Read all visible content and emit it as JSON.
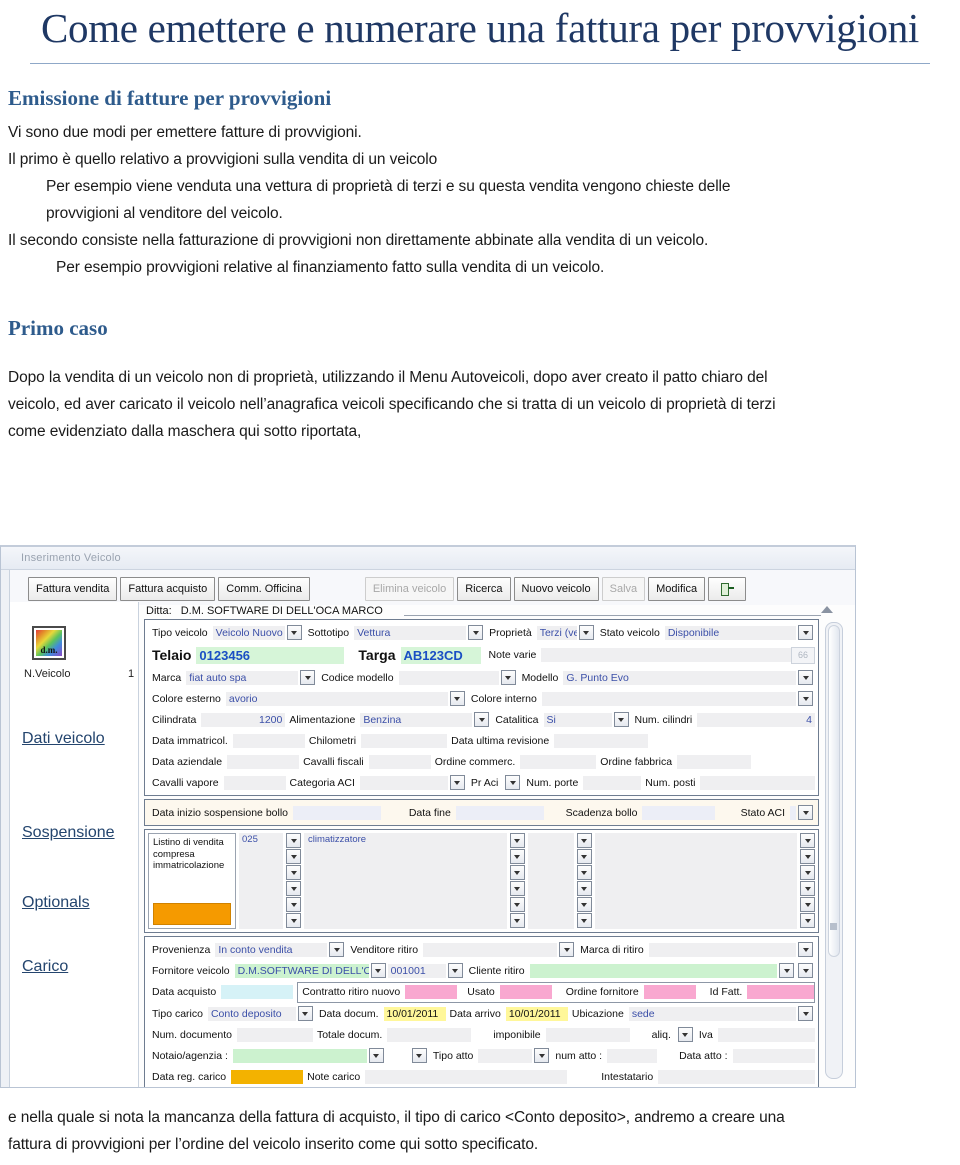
{
  "document": {
    "title": "Come emettere e numerare una fattura per provvigioni",
    "heading1": "Emissione di fatture per provvigioni",
    "paragraphs": [
      "Vi sono due modi per emettere fatture di provvigioni.",
      "Il  primo è quello relativo a provvigioni sulla vendita di un veicolo",
      "Per esempio viene venduta una vettura di proprietà di terzi e su questa vendita vengono chieste delle",
      "provvigioni al  venditore del veicolo.",
      "Il  secondo consiste nella fatturazione di provvigioni  non direttamente abbinate alla vendita di un veicolo.",
      "Per esempio provvigioni relative al finanziamento fatto sulla vendita di un veicolo."
    ],
    "heading2": "Primo caso",
    "intro": [
      "Dopo la vendita di un veicolo non di proprietà, utilizzando il Menu Autoveicoli, dopo aver creato il patto chiaro del",
      "veicolo, ed aver caricato il veicolo nell’anagrafica veicoli specificando che si tratta di un veicolo di proprietà di terzi",
      "come evidenziato dalla maschera qui sotto riportata,"
    ],
    "outro": [
      "e nella quale si nota la mancanza della fattura di acquisto,  il tipo di carico <Conto deposito>, andremo a creare  una",
      "fattura di provvigioni per l’ordine del veicolo inserito come qui sotto specificato."
    ]
  },
  "app": {
    "window_title": "Inserimento Veicolo",
    "toolbar": [
      {
        "label": "Fattura vendita",
        "disabled": false
      },
      {
        "label": "Fattura acquisto",
        "disabled": false
      },
      {
        "label": "Comm. Officina",
        "disabled": false
      },
      {
        "label": "Elimina veicolo",
        "disabled": true
      },
      {
        "label": "Ricerca",
        "disabled": false
      },
      {
        "label": "Nuovo veicolo",
        "disabled": false
      },
      {
        "label": "Salva",
        "disabled": true
      },
      {
        "label": "Modifica",
        "disabled": false
      }
    ],
    "exit_icon": "exit-door-icon",
    "rail": {
      "logo_text": "d.m.",
      "n_veicolo_label": "N.Veicolo",
      "n_veicolo_value": "1",
      "links": [
        "Dati veicolo",
        "Sospensione",
        "Optionals",
        "Carico"
      ]
    },
    "ditta": {
      "label": "Ditta:",
      "value": "D.M. SOFTWARE DI DELL'OCA MARCO"
    },
    "dati_veicolo": {
      "r1": {
        "tipo_veicolo_label": "Tipo veicolo",
        "tipo_veicolo_value": "Veicolo Nuovo",
        "sottotipo_label": "Sottotipo",
        "sottotipo_value": "Vettura",
        "proprieta_label": "Proprietà",
        "proprieta_value": "Terzi (ve",
        "stato_label": "Stato veicolo",
        "stato_value": "Disponibile"
      },
      "r2": {
        "telaio_label": "Telaio",
        "telaio_value": "0123456",
        "targa_label": "Targa",
        "targa_value": "AB123CD",
        "note_label": "Note varie",
        "note_value": "",
        "binoc_icon": "binoculars-icon"
      },
      "r3": {
        "marca_label": "Marca",
        "marca_value": "fiat auto spa",
        "codice_modello_label": "Codice modello",
        "codice_modello_value": "",
        "modello_label": "Modello",
        "modello_value": "G. Punto Evo"
      },
      "r4": {
        "colore_est_label": "Colore esterno",
        "colore_est_value": "avorio",
        "colore_int_label": "Colore interno",
        "colore_int_value": ""
      },
      "r5": {
        "cilindrata_label": "Cilindrata",
        "cilindrata_value": "1200",
        "alimentazione_label": "Alimentazione",
        "alimentazione_value": "Benzina",
        "catalitica_label": "Catalitica",
        "catalitica_value": "Si",
        "num_cilindri_label": "Num. cilindri",
        "num_cilindri_value": "4"
      },
      "r6": {
        "data_immatr_label": "Data immatricol.",
        "data_immatr_value": "",
        "chilometri_label": "Chilometri",
        "chilometri_value": "",
        "data_rev_label": "Data ultima revisione",
        "data_rev_value": ""
      },
      "r7": {
        "data_az_label": "Data aziendale",
        "data_az_value": "",
        "cavalli_fisc_label": "Cavalli fiscali",
        "cavalli_fisc_value": "",
        "ordine_comm_label": "Ordine commerc.",
        "ordine_comm_value": "",
        "ordine_fabb_label": "Ordine fabbrica",
        "ordine_fabb_value": ""
      },
      "r8": {
        "cavalli_vap_label": "Cavalli vapore",
        "cavalli_vap_value": "",
        "cat_aci_label": "Categoria ACI",
        "cat_aci_value": "",
        "pr_aci_label": "Pr  Aci",
        "pr_aci_value": "",
        "num_porte_label": "Num. porte",
        "num_porte_value": "",
        "num_posti_label": "Num. posti",
        "num_posti_value": ""
      }
    },
    "sospensione": {
      "data_inizio_label": "Data inizio sospensione bollo",
      "data_inizio_value": "",
      "data_fine_label": "Data fine",
      "data_fine_value": "",
      "scadenza_label": "Scadenza bollo",
      "scadenza_value": "",
      "stato_aci_label": "Stato ACI",
      "stato_aci_value": ""
    },
    "optionals": {
      "box_text": "Listino di vendita compresa immatricolazione",
      "code_value": "025",
      "desc_value": "climatizzatore",
      "rows": 7
    },
    "carico": {
      "r1": {
        "provenienza_label": "Provenienza",
        "provenienza_value": "In conto vendita",
        "venditore_label": "Venditore ritiro",
        "venditore_value": "",
        "marca_ritiro_label": "Marca di ritiro",
        "marca_ritiro_value": ""
      },
      "r2": {
        "fornitore_label": "Fornitore veicolo",
        "fornitore_value": "D.M.SOFTWARE DI DELL'OCA M",
        "codice_value": "001001",
        "cliente_label": "Cliente ritiro",
        "cliente_value": ""
      },
      "r3": {
        "data_acq_label": "Data acquisto",
        "data_acq_value": "",
        "contratto_label": "Contratto ritiro nuovo",
        "contratto_value": "",
        "usato_label": "Usato",
        "usato_value": "",
        "ordine_forn_label": "Ordine fornitore",
        "ordine_forn_value": "",
        "id_fatt_label": "Id Fatt.",
        "id_fatt_value": ""
      },
      "r4": {
        "tipo_carico_label": "Tipo carico",
        "tipo_carico_value": "Conto deposito",
        "data_docum_label": "Data docum.",
        "data_docum_value": "10/01/2011",
        "data_arrivo_label": "Data arrivo",
        "data_arrivo_value": "10/01/2011",
        "ubicazione_label": "Ubicazione",
        "ubicazione_value": "sede"
      },
      "r5": {
        "num_doc_label": "Num. documento",
        "num_doc_value": "",
        "totale_label": "Totale docum.",
        "totale_value": "",
        "imponibile_label": "imponibile",
        "imponibile_value": "",
        "aliq_label": "aliq.",
        "aliq_value": "",
        "iva_label": "Iva",
        "iva_value": ""
      },
      "r6": {
        "notaio_label": "Notaio/agenzia :",
        "notaio_value": "",
        "tipo_atto_label": "Tipo atto",
        "tipo_atto_value": "",
        "num_atto_label": "num atto :",
        "num_atto_value": "",
        "data_atto_label": "Data atto :",
        "data_atto_value": ""
      },
      "r7": {
        "data_reg_label": "Data reg. carico",
        "data_reg_value": "",
        "note_carico_label": "Note carico",
        "note_carico_value": "",
        "intestatario_label": "Intestatario",
        "intestatario_value": ""
      }
    }
  },
  "colors": {
    "title": "#1F3864",
    "heading": "#2E5B8C",
    "field_value": "#3b4fa8",
    "highlight_green": "#d6f5d8",
    "highlight_pink": "#f9a8d0",
    "highlight_yellow": "#fff79a",
    "highlight_orange": "#f59a00"
  }
}
